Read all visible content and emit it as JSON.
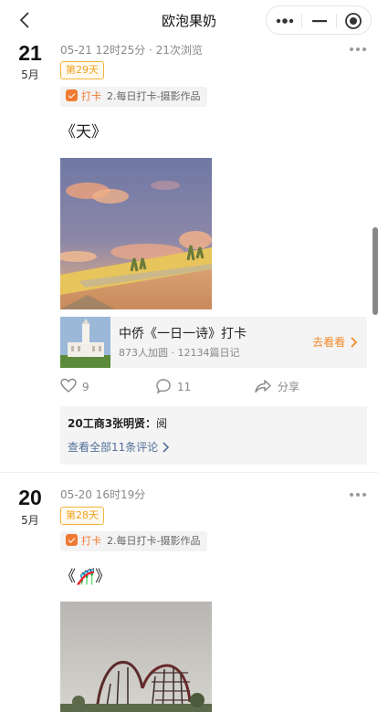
{
  "nav": {
    "title": "欧泡果奶",
    "back_icon": "chevron-left-icon",
    "menu_icon": "more-dots-icon",
    "minimize_icon": "minimize-icon",
    "close_icon": "target-close-icon"
  },
  "posts": [
    {
      "day": "21",
      "month": "5月",
      "meta": "05-21 12时25分 · 21次浏览",
      "badge": "第29天",
      "tag_kind": "打卡",
      "tag_label": "2.每日打卡-摄影作品",
      "text": "《天》",
      "photo": "sky-sunset-wall-photo",
      "card": {
        "title": "中侨《一日一诗》打卡",
        "sub": "873人加圆 · 12134篇日记",
        "action": "去看看"
      },
      "likes": "9",
      "comments": "11",
      "share": "分享",
      "comment_line_user": "20工商3张明贤：",
      "comment_line_text": "阅",
      "view_all": "查看全部11条评论"
    },
    {
      "day": "20",
      "month": "5月",
      "meta": "05-20 16时19分",
      "badge": "第28天",
      "tag_kind": "打卡",
      "tag_label": "2.每日打卡-摄影作品",
      "text": "《🎢》",
      "photo": "roller-coaster-photo"
    }
  ],
  "colors": {
    "accent_orange": "#f07a33",
    "badge_gold": "#f0a21f",
    "link_blue": "#51709a"
  }
}
